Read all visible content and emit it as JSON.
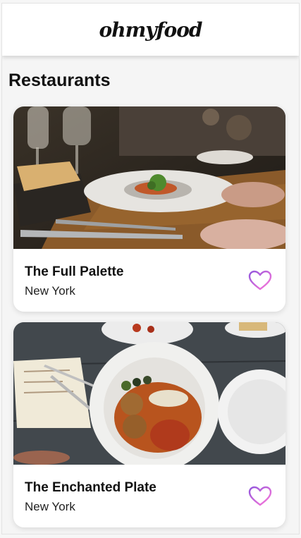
{
  "header": {
    "logo_text": "ohmyfood"
  },
  "main": {
    "title": "Restaurants",
    "restaurants": [
      {
        "name": "The Full Palette",
        "location": "New York",
        "photo_icon": "plated-dish-table-photo",
        "favorite_icon": "heart-outline-icon"
      },
      {
        "name": "The Enchanted Plate",
        "location": "New York",
        "photo_icon": "meatball-plate-photo",
        "favorite_icon": "heart-outline-icon"
      }
    ]
  },
  "colors": {
    "accent": "#9356dc",
    "accent_secondary": "#ff79da",
    "background": "#f5f5f5"
  }
}
